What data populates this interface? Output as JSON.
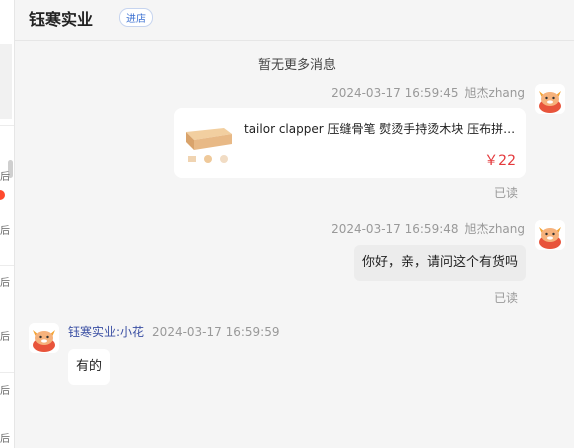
{
  "header": {
    "shop_name": "钰寒实业",
    "enter_shop_label": "进店"
  },
  "no_more": "暂无更多消息",
  "left_strip": {
    "snippets": [
      "后",
      "后",
      "后",
      "后",
      "后",
      "后"
    ]
  },
  "messages": {
    "m1": {
      "time": "2024-03-17 16:59:45",
      "sender": "旭杰zhang",
      "product": {
        "title": "tailor clapper 压缝骨笔 熨烫手持烫木块 压布拼布用布匠...",
        "price": "￥22"
      },
      "status": "已读"
    },
    "m2": {
      "time": "2024-03-17 16:59:48",
      "sender": "旭杰zhang",
      "text": "你好，亲，请问这个有货吗",
      "status": "已读"
    },
    "m3": {
      "sender": "钰寒实业:小花",
      "time": "2024-03-17 16:59:59",
      "text": "有的"
    }
  },
  "icons": {
    "avatar": "orange-cartoon-animal-avatar-icon",
    "product": "wooden-clapper-product-image"
  },
  "colors": {
    "price": "#e4393c",
    "sender_link": "#3a4fa3",
    "badge": "#3a6fd1"
  }
}
